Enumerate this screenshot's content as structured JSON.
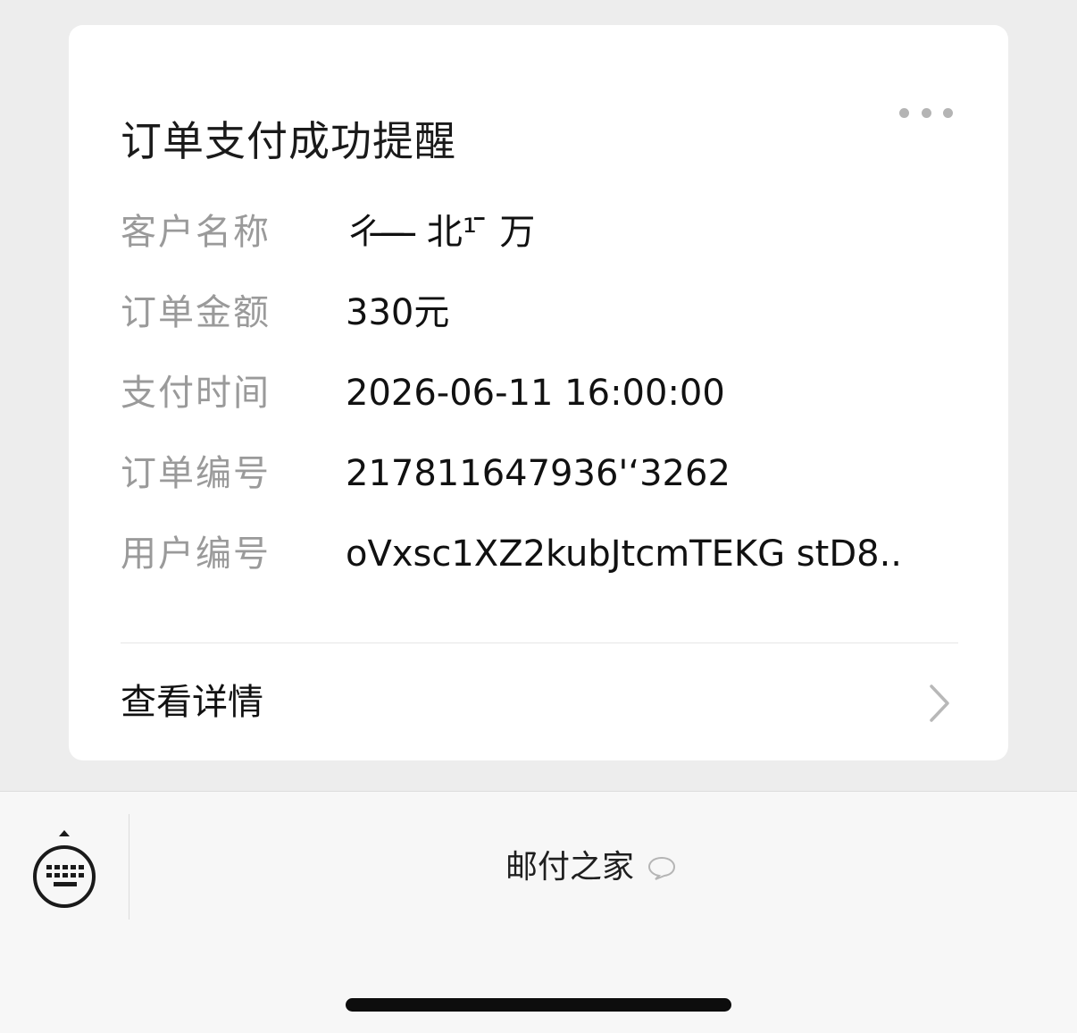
{
  "card": {
    "title": "订单支付成功提醒",
    "fields": [
      {
        "label": "客户名称",
        "value": "ㄔ  ̶ ̶ ̶ 北¹        ̄ 万"
      },
      {
        "label": "订单金额",
        "value": "330元"
      },
      {
        "label": "支付时间",
        "value": "2026-06-11 16:00:00"
      },
      {
        "label": "订单编号",
        "value": "217811647936'‘3262"
      },
      {
        "label": "用户编号",
        "value": "oVxsc1XZ2kubJtcmTEKG stD8.."
      }
    ],
    "detail_label": "查看详情"
  },
  "bottom_bar": {
    "menu_label": "邮付之家"
  },
  "icons": {
    "more": "more-dots-icon",
    "chevron": "chevron-right-icon",
    "keyboard": "keyboard-icon",
    "bubble": "speech-bubble-icon"
  }
}
